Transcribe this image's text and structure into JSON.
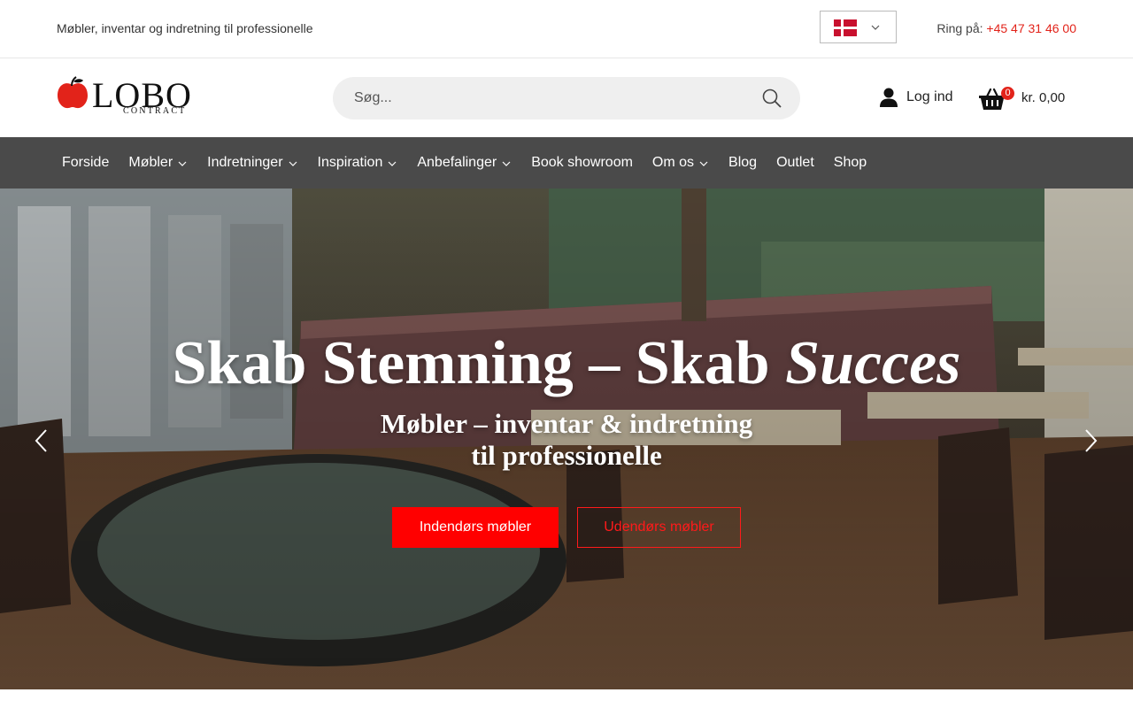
{
  "topbar": {
    "tagline": "Møbler, inventar og indretning til professionelle",
    "language": "Dansk",
    "phone_label": "Ring på:",
    "phone_number": "+45 47 31 46 00"
  },
  "header": {
    "logo_word": "LOBO",
    "logo_sub": "CONTRACT",
    "search_placeholder": "Søg...",
    "login_label": "Log ind",
    "cart_count": "0",
    "cart_amount": "kr. 0,00"
  },
  "nav": {
    "items": [
      {
        "label": "Forside",
        "has_dropdown": false
      },
      {
        "label": "Møbler",
        "has_dropdown": true
      },
      {
        "label": "Indretninger",
        "has_dropdown": true
      },
      {
        "label": "Inspiration",
        "has_dropdown": true
      },
      {
        "label": "Anbefalinger",
        "has_dropdown": true
      },
      {
        "label": "Book showroom",
        "has_dropdown": false
      },
      {
        "label": "Om os",
        "has_dropdown": true
      },
      {
        "label": "Blog",
        "has_dropdown": false
      },
      {
        "label": "Outlet",
        "has_dropdown": false
      },
      {
        "label": "Shop",
        "has_dropdown": false
      }
    ]
  },
  "hero": {
    "title_main": "Skab Stemning – Skab ",
    "title_emph": "Succes",
    "subtitle_line1": "Møbler – inventar & indretning",
    "subtitle_line2": "til professionelle",
    "primary_button": "Indendørs møbler",
    "secondary_button": "Udendørs møbler"
  },
  "colors": {
    "accent": "#ff0000",
    "nav_bg": "#4a4a4a",
    "phone": "#e2231a"
  },
  "icons": [
    "danish-flag-icon",
    "chevron-down-icon",
    "search-icon",
    "user-icon",
    "basket-icon",
    "arrow-left-icon",
    "arrow-right-icon",
    "apple-logo-icon"
  ]
}
